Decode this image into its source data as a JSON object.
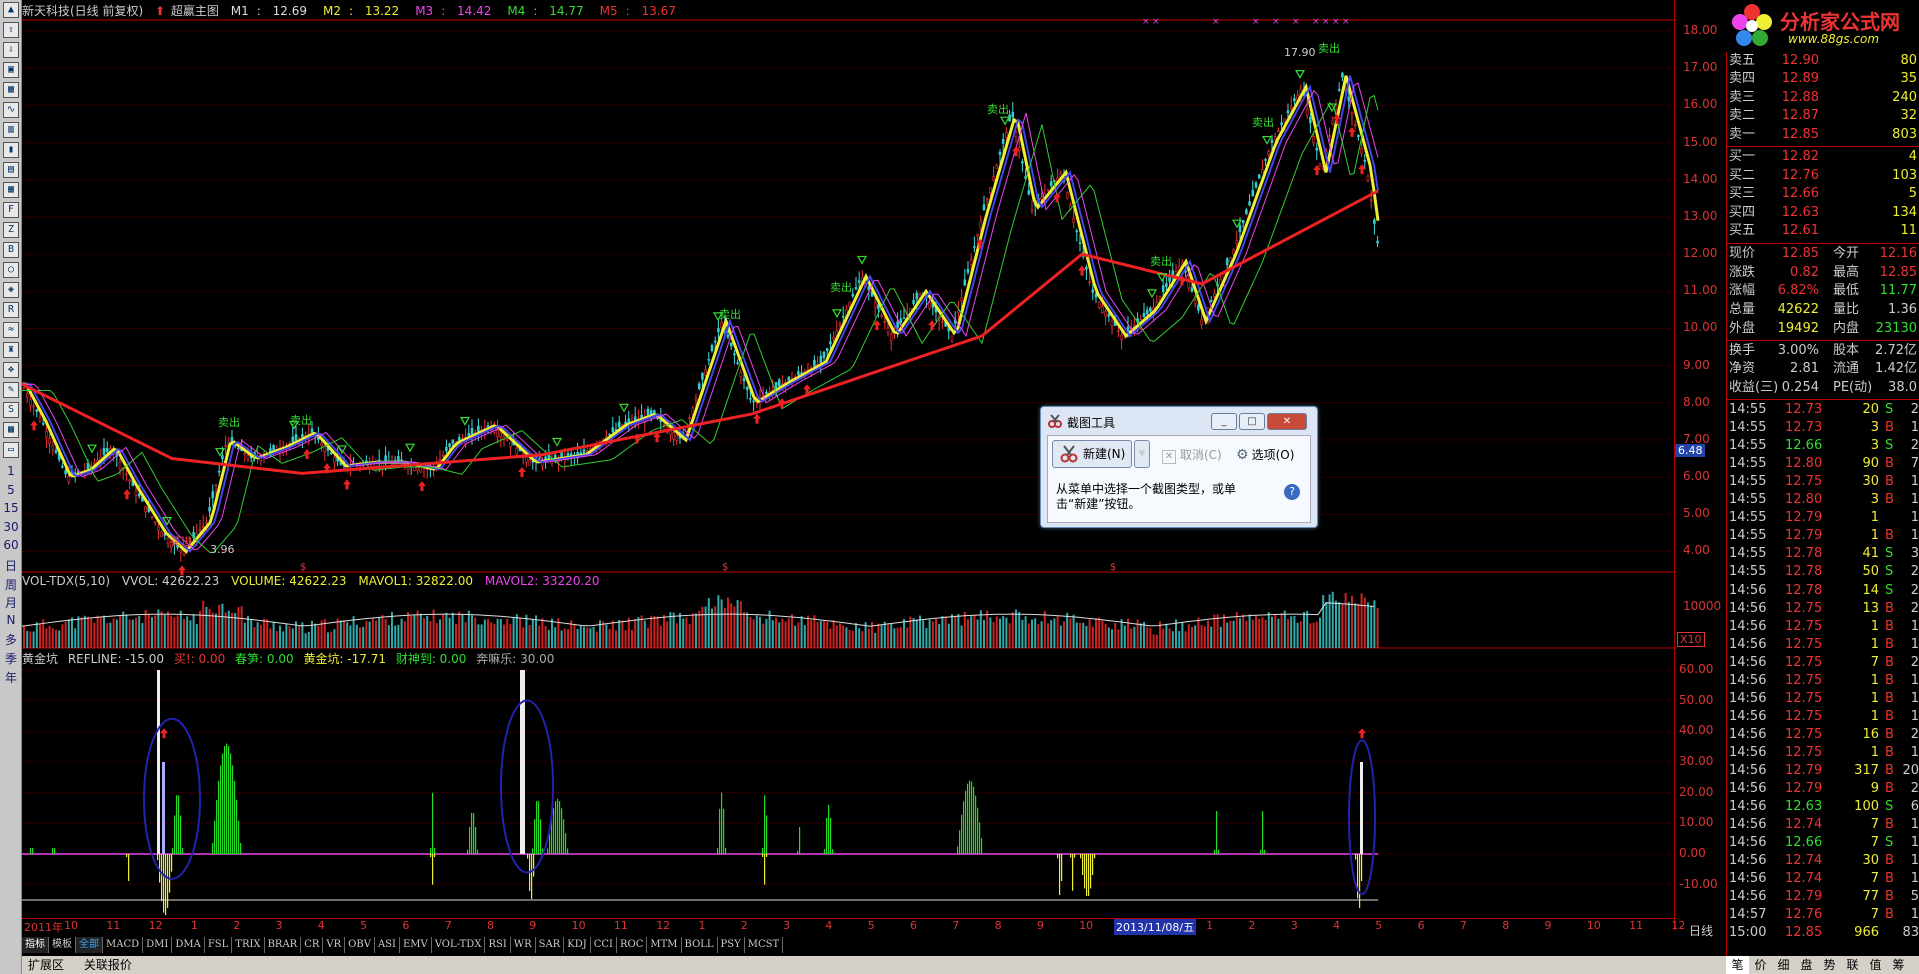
{
  "chart_title": "新天科技(日线 前复权)",
  "main_indicator": "超赢主图",
  "ma": [
    {
      "name": "M1",
      "value": "12.69",
      "color": "#dddddd"
    },
    {
      "name": "M2",
      "value": "13.22",
      "color": "#eeee33"
    },
    {
      "name": "M3",
      "value": "14.42",
      "color": "#ee44ee"
    },
    {
      "name": "M4",
      "value": "14.77",
      "color": "#33dd33"
    },
    {
      "name": "M5",
      "value": "13.67",
      "color": "#ee3333"
    }
  ],
  "price_axis": [
    "18.00",
    "17.00",
    "16.00",
    "15.00",
    "14.00",
    "13.00",
    "12.00",
    "11.00",
    "10.00",
    "9.00",
    "8.00",
    "7.00",
    "6.00",
    "5.00",
    "4.00"
  ],
  "price_marker": "6.48",
  "annotations": {
    "high": "17.90",
    "low": "3.96",
    "sell": "卖出",
    "buy": "买进"
  },
  "volume": {
    "name": "VOL-TDX(5,10)",
    "vvol": "VVOL: 42622.23",
    "volume": "VOLUME: 42622.23",
    "mavol1": "MAVOL1: 32822.00",
    "mavol2": "MAVOL2: 33220.20",
    "axis_top": "10000",
    "unit": "X10"
  },
  "indicator": {
    "name": "黄金坑",
    "refline": "REFLINE: -15.00",
    "mai": "买!: 0.00",
    "chunsun": "春笋: 0.00",
    "huangjinkeng": "黄金坑: -17.71",
    "caishendao": "财神到: 0.00",
    "bengmale": "奔嘛乐: 30.00",
    "axis": [
      "60.00",
      "50.00",
      "40.00",
      "30.00",
      "20.00",
      "10.00",
      "0.00",
      "-10.00"
    ]
  },
  "time_axis": {
    "labels": [
      "2011年",
      "10",
      "11",
      "12",
      "1",
      "2",
      "3",
      "4",
      "5",
      "6",
      "7",
      "8",
      "9",
      "10",
      "11",
      "12",
      "1",
      "2",
      "3",
      "4",
      "5",
      "6",
      "7",
      "8",
      "9",
      "10",
      "11",
      "12",
      "1",
      "2",
      "3",
      "4",
      "5",
      "6",
      "7",
      "8",
      "9",
      "10",
      "11",
      "12"
    ],
    "badge": "2013/11/08/五",
    "period": "日线"
  },
  "left_toolbar": {
    "periods": [
      "1",
      "5",
      "15",
      "30",
      "60",
      "日",
      "周",
      "月",
      "N",
      "多",
      "季",
      "年"
    ]
  },
  "tabs": [
    "指标",
    "模板",
    "全部",
    "MACD",
    "DMI",
    "DMA",
    "FSL",
    "TRIX",
    "BRAR",
    "CR",
    "VR",
    "OBV",
    "ASI",
    "EMV",
    "VOL-TDX",
    "RSI",
    "WR",
    "SAR",
    "KDJ",
    "CCI",
    "ROC",
    "MTM",
    "BOLL",
    "PSY",
    "MCST"
  ],
  "bottom_bar": [
    "扩展区",
    "关联报价"
  ],
  "logo": {
    "title": "分析家公式网",
    "url": "www.88gs.com"
  },
  "order_book": {
    "asks": [
      {
        "label": "卖五",
        "price": "12.90",
        "vol": "80"
      },
      {
        "label": "卖四",
        "price": "12.89",
        "vol": "35"
      },
      {
        "label": "卖三",
        "price": "12.88",
        "vol": "240"
      },
      {
        "label": "卖二",
        "price": "12.87",
        "vol": "32"
      },
      {
        "label": "卖一",
        "price": "12.85",
        "vol": "803"
      }
    ],
    "bids": [
      {
        "label": "买一",
        "price": "12.82",
        "vol": "4"
      },
      {
        "label": "买二",
        "price": "12.76",
        "vol": "103"
      },
      {
        "label": "买三",
        "price": "12.66",
        "vol": "5"
      },
      {
        "label": "买四",
        "price": "12.63",
        "vol": "134"
      },
      {
        "label": "买五",
        "price": "12.61",
        "vol": "11"
      }
    ]
  },
  "quote": [
    {
      "l1": "现价",
      "v1": "12.85",
      "l2": "今开",
      "v2": "12.16"
    },
    {
      "l1": "涨跌",
      "v1": "0.82",
      "l2": "最高",
      "v2": "12.85"
    },
    {
      "l1": "涨幅",
      "v1": "6.82%",
      "l2": "最低",
      "v2": "11.77"
    },
    {
      "l1": "总量",
      "v1": "42622",
      "l2": "量比",
      "v2": "1.36"
    },
    {
      "l1": "外盘",
      "v1": "19492",
      "l2": "内盘",
      "v2": "23130"
    },
    {
      "l1": "换手",
      "v1": "3.00%",
      "l2": "股本",
      "v2": "2.72亿"
    },
    {
      "l1": "净资",
      "v1": "2.81",
      "l2": "流通",
      "v2": "1.42亿"
    },
    {
      "l1": "收益(三)",
      "v1": "0.254",
      "l2": "PE(动)",
      "v2": "38.0"
    }
  ],
  "ticks": [
    {
      "t": "14:55",
      "p": "12.73",
      "v": "20",
      "s": "S",
      "n": "2"
    },
    {
      "t": "14:55",
      "p": "12.73",
      "v": "3",
      "s": "B",
      "n": "1"
    },
    {
      "t": "14:55",
      "p": "12.66",
      "v": "3",
      "s": "S",
      "n": "2"
    },
    {
      "t": "14:55",
      "p": "12.80",
      "v": "90",
      "s": "B",
      "n": "7"
    },
    {
      "t": "14:55",
      "p": "12.75",
      "v": "30",
      "s": "B",
      "n": "1"
    },
    {
      "t": "14:55",
      "p": "12.80",
      "v": "3",
      "s": "B",
      "n": "1"
    },
    {
      "t": "14:55",
      "p": "12.79",
      "v": "1",
      "s": "",
      "n": "1"
    },
    {
      "t": "14:55",
      "p": "12.79",
      "v": "1",
      "s": "B",
      "n": "1"
    },
    {
      "t": "14:55",
      "p": "12.78",
      "v": "41",
      "s": "S",
      "n": "3"
    },
    {
      "t": "14:55",
      "p": "12.78",
      "v": "50",
      "s": "S",
      "n": "2"
    },
    {
      "t": "14:56",
      "p": "12.78",
      "v": "14",
      "s": "S",
      "n": "2"
    },
    {
      "t": "14:56",
      "p": "12.75",
      "v": "13",
      "s": "B",
      "n": "2"
    },
    {
      "t": "14:56",
      "p": "12.75",
      "v": "1",
      "s": "B",
      "n": "1"
    },
    {
      "t": "14:56",
      "p": "12.75",
      "v": "1",
      "s": "B",
      "n": "1"
    },
    {
      "t": "14:56",
      "p": "12.75",
      "v": "7",
      "s": "B",
      "n": "2"
    },
    {
      "t": "14:56",
      "p": "12.75",
      "v": "1",
      "s": "B",
      "n": "1"
    },
    {
      "t": "14:56",
      "p": "12.75",
      "v": "1",
      "s": "B",
      "n": "1"
    },
    {
      "t": "14:56",
      "p": "12.75",
      "v": "1",
      "s": "B",
      "n": "1"
    },
    {
      "t": "14:56",
      "p": "12.75",
      "v": "16",
      "s": "B",
      "n": "2"
    },
    {
      "t": "14:56",
      "p": "12.75",
      "v": "1",
      "s": "B",
      "n": "1"
    },
    {
      "t": "14:56",
      "p": "12.79",
      "v": "317",
      "s": "B",
      "n": "20"
    },
    {
      "t": "14:56",
      "p": "12.79",
      "v": "9",
      "s": "B",
      "n": "2"
    },
    {
      "t": "14:56",
      "p": "12.63",
      "v": "100",
      "s": "S",
      "n": "6"
    },
    {
      "t": "14:56",
      "p": "12.74",
      "v": "7",
      "s": "B",
      "n": "1"
    },
    {
      "t": "14:56",
      "p": "12.66",
      "v": "7",
      "s": "S",
      "n": "1"
    },
    {
      "t": "14:56",
      "p": "12.74",
      "v": "30",
      "s": "B",
      "n": "1"
    },
    {
      "t": "14:56",
      "p": "12.74",
      "v": "7",
      "s": "B",
      "n": "1"
    },
    {
      "t": "14:56",
      "p": "12.79",
      "v": "77",
      "s": "B",
      "n": "5"
    },
    {
      "t": "14:57",
      "p": "12.76",
      "v": "7",
      "s": "B",
      "n": "1"
    },
    {
      "t": "15:00",
      "p": "12.85",
      "v": "966",
      "s": "",
      "n": "83"
    }
  ],
  "rp_tabs": [
    "笔",
    "价",
    "细",
    "盘",
    "势",
    "联",
    "值",
    "筹"
  ],
  "dialog": {
    "title": "截图工具",
    "new_label": "新建(N)",
    "cancel_label": "取消(C)",
    "options_label": "选项(O)",
    "message": "从菜单中选择一个截图类型，或单击“新建”按钮。",
    "help": "?"
  },
  "chart_data": [
    {
      "type": "candlestick",
      "title": "新天科技(日线 前复权)",
      "ylim": [
        3.5,
        18.3
      ],
      "x_range": [
        "2011-09",
        "2014-01"
      ],
      "series": [
        {
          "name": "M5",
          "x": [
            "2011-09",
            "2011-12",
            "2012-04",
            "2012-09",
            "2013-01",
            "2013-06",
            "2013-09",
            "2013-11",
            "2014-01"
          ],
          "values": [
            8.5,
            6.5,
            6.1,
            6.6,
            7.7,
            9.8,
            12.0,
            11.2,
            13.7
          ]
        }
      ],
      "annotations": [
        {
          "label": "17.90"
        },
        {
          "label": "3.96"
        }
      ]
    },
    {
      "type": "bar",
      "title": "VOL-TDX(5,10)",
      "ylim": [
        0,
        12000
      ],
      "axis_ticks": [
        "10000"
      ]
    },
    {
      "type": "bar",
      "title": "黄金坑",
      "ylim": [
        -15,
        60
      ],
      "axis_ticks": [
        "60.00",
        "50.00",
        "40.00",
        "30.00",
        "20.00",
        "10.00",
        "0.00",
        "-10.00"
      ]
    }
  ]
}
